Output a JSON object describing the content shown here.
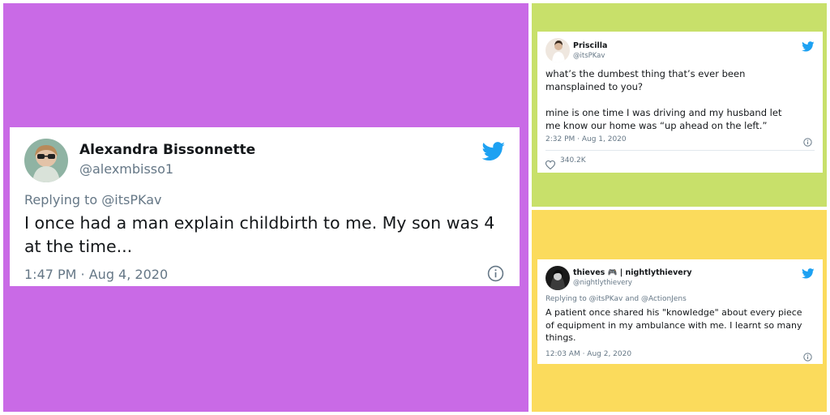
{
  "colors": {
    "panel_left": "#c96ae6",
    "panel_top_right": "#c8e06a",
    "panel_bottom_right": "#fbdb5c",
    "twitter_blue": "#1da1f2",
    "text_secondary": "#657786"
  },
  "tweets": [
    {
      "name": "Alexandra Bissonnette",
      "handle": "@alexmbisso1",
      "replying_to": "Replying to @itsPKav",
      "text": "I once had a man explain childbirth to me. My son was 4 at the time...",
      "timestamp": "1:47 PM · Aug 4, 2020",
      "icons": [
        "avatar",
        "twitter-bird-icon",
        "info-icon"
      ]
    },
    {
      "name": "Priscilla",
      "handle": "@itsPKav",
      "text_lines": [
        "what’s the dumbest thing that’s ever been",
        "mansplained to you?",
        "",
        "mine is one time I was driving and my husband let",
        "me know our home was “up ahead on the left.”"
      ],
      "timestamp": "2:32 PM · Aug 1, 2020",
      "likes": "340.2K",
      "icons": [
        "avatar",
        "twitter-bird-icon",
        "info-icon",
        "heart-icon"
      ]
    },
    {
      "name": "thieves 🎮 | nightlythievery",
      "handle": "@nightlythievery",
      "replying_to": "Replying to @itsPKav and @ActionJens",
      "text": "A patient once shared his \"knowledge\" about every piece of equipment in my ambulance with me. I learnt so many things.",
      "timestamp": "12:03 AM · Aug 2, 2020",
      "icons": [
        "avatar",
        "twitter-bird-icon",
        "info-icon"
      ]
    }
  ]
}
